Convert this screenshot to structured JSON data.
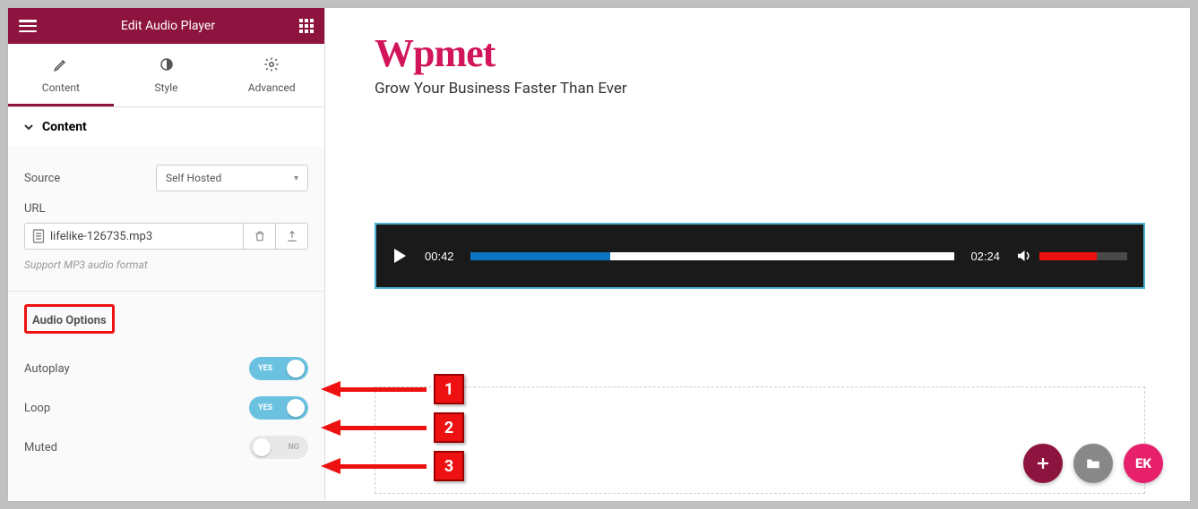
{
  "header": {
    "title": "Edit Audio Player"
  },
  "tabs": {
    "content": "Content",
    "style": "Style",
    "advanced": "Advanced"
  },
  "section": {
    "title": "Content",
    "source_label": "Source",
    "source_value": "Self Hosted",
    "url_label": "URL",
    "url_value": "lifelike-126735.mp3",
    "url_hint": "Support MP3 audio format"
  },
  "audio_options": {
    "heading": "Audio Options",
    "autoplay_label": "Autoplay",
    "loop_label": "Loop",
    "muted_label": "Muted",
    "yes": "YES",
    "no": "NO"
  },
  "canvas": {
    "brand": "Wpmet",
    "subtitle": "Grow Your Business Faster Than Ever"
  },
  "player": {
    "current_time": "00:42",
    "total_time": "02:24",
    "progress_percent": 29,
    "volume_percent": 65
  },
  "annotations": {
    "n1": "1",
    "n2": "2",
    "n3": "3"
  },
  "fab": {
    "ek": "EK"
  }
}
